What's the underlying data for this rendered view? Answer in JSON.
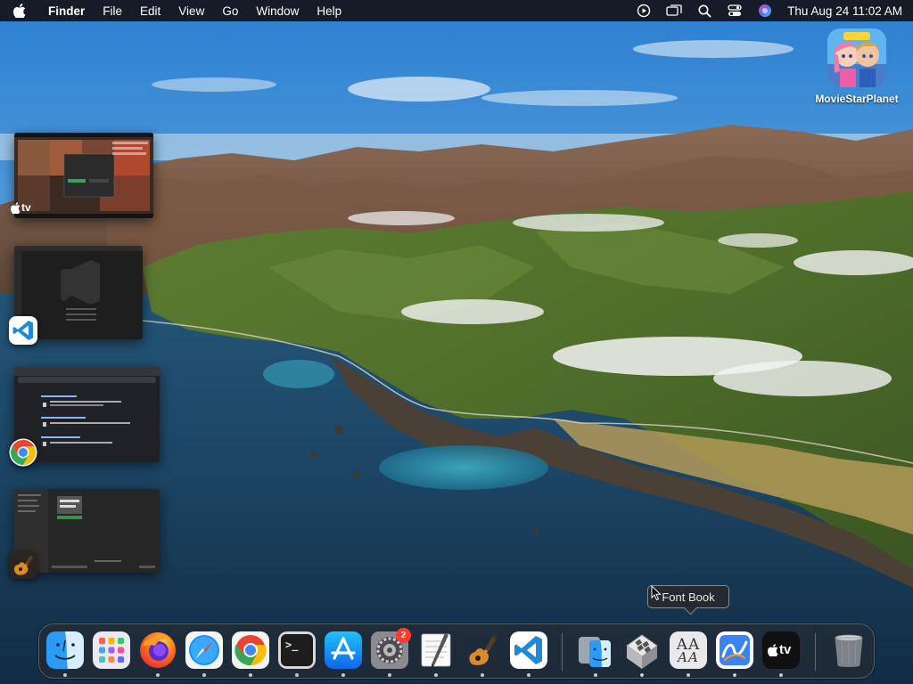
{
  "menubar": {
    "apple_icon": "apple-logo-icon",
    "app_name": "Finder",
    "items": [
      "File",
      "Edit",
      "View",
      "Go",
      "Window",
      "Help"
    ],
    "status_icons": [
      "screen-recording-icon",
      "screen-mirroring-icon",
      "spotlight-search-icon",
      "control-center-icon",
      "siri-icon"
    ],
    "clock": "Thu Aug 24  11:02 AM"
  },
  "desktop": {
    "icons": [
      {
        "label": "MovieStarPlanet",
        "icon": "moviestarplanet-icon"
      }
    ]
  },
  "stage_manager": {
    "groups": [
      {
        "app": "Apple TV",
        "icon": "apple-tv-icon",
        "thumb_label": "tv"
      },
      {
        "app": "Visual Studio Code",
        "icon": "vscode-icon"
      },
      {
        "app": "Google Chrome",
        "icon": "chrome-icon"
      },
      {
        "app": "GarageBand",
        "icon": "garageband-icon"
      }
    ]
  },
  "dock": {
    "apps": [
      {
        "name": "Finder",
        "icon": "finder-icon",
        "running": true
      },
      {
        "name": "Launchpad",
        "icon": "launchpad-icon",
        "running": false
      },
      {
        "name": "Firefox",
        "icon": "firefox-icon",
        "running": true
      },
      {
        "name": "Safari",
        "icon": "safari-icon",
        "running": true
      },
      {
        "name": "Google Chrome",
        "icon": "chrome-icon",
        "running": true
      },
      {
        "name": "Terminal",
        "icon": "terminal-icon",
        "running": true
      },
      {
        "name": "App Store",
        "icon": "app-store-icon",
        "running": true
      },
      {
        "name": "System Settings",
        "icon": "system-settings-icon",
        "running": true,
        "badge": "2"
      },
      {
        "name": "TextEdit",
        "icon": "textedit-icon",
        "running": true
      },
      {
        "name": "GarageBand",
        "icon": "garageband-icon",
        "running": true
      },
      {
        "name": "Visual Studio Code",
        "icon": "vscode-icon",
        "running": true
      },
      {
        "name": "Migration Assistant",
        "icon": "migration-assistant-icon",
        "running": true
      },
      {
        "name": "Boot Camp Assistant",
        "icon": "boot-camp-icon",
        "running": true
      },
      {
        "name": "Font Book",
        "icon": "font-book-icon",
        "running": true
      },
      {
        "name": "Freeform",
        "icon": "freeform-icon",
        "running": true
      },
      {
        "name": "Apple TV",
        "icon": "apple-tv-icon",
        "running": true
      },
      {
        "name": "Trash",
        "icon": "trash-icon",
        "running": false
      }
    ],
    "terminal_prompt": ">_",
    "system_settings_badge": "2",
    "font_book_glyph": "AA",
    "tv_label": "tv",
    "tooltip": "Font Book"
  },
  "colors": {
    "menubar_bg": "#141418",
    "badge": "#ff3b30",
    "vscode_blue": "#1f8ad6"
  }
}
